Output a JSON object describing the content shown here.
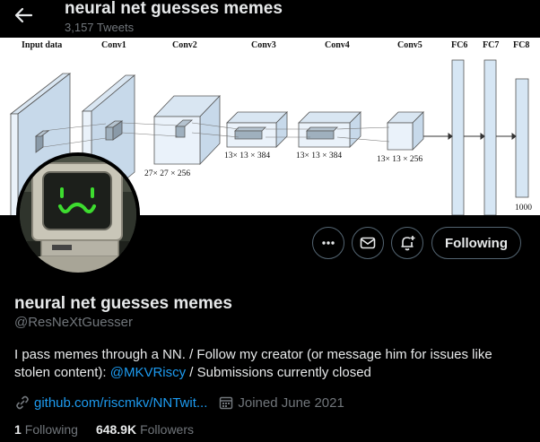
{
  "header": {
    "title": "neural net guesses memes",
    "tweet_count": "3,157 Tweets"
  },
  "banner": {
    "layers": [
      {
        "label": "Input data"
      },
      {
        "label": "Conv1"
      },
      {
        "label": "Conv2",
        "dims": "27× 27 × 256"
      },
      {
        "label": "Conv3",
        "dims": "13× 13 × 384"
      },
      {
        "label": "Conv4",
        "dims": "13× 13 × 384"
      },
      {
        "label": "Conv5",
        "dims": "13× 13 × 256"
      },
      {
        "label": "FC6"
      },
      {
        "label": "FC7"
      },
      {
        "label": "FC8",
        "dims": "1000"
      }
    ]
  },
  "actions": {
    "follow_label": "Following",
    "more_icon": "more-icon",
    "message_icon": "envelope-icon",
    "notify_icon": "bell-plus-icon"
  },
  "profile": {
    "name": "neural net guesses memes",
    "handle": "@ResNeXtGuesser",
    "bio_text": "I pass memes through a NN. / Follow my creator (or message him for issues like stolen content): ",
    "bio_mention": "@MKVRiscy",
    "bio_tail": " / Submissions currently closed",
    "website": "github.com/riscmkv/NNTwit...",
    "joined": "Joined June 2021"
  },
  "stats": {
    "following_count": "1",
    "following_label": "Following",
    "followers_count": "648.9K",
    "followers_label": "Followers"
  },
  "colors": {
    "accent": "#1d9bf0",
    "background": "#000000",
    "text": "#e7e9ea",
    "secondary_text": "#71767b",
    "avatar_face": "#3ddc2f"
  }
}
